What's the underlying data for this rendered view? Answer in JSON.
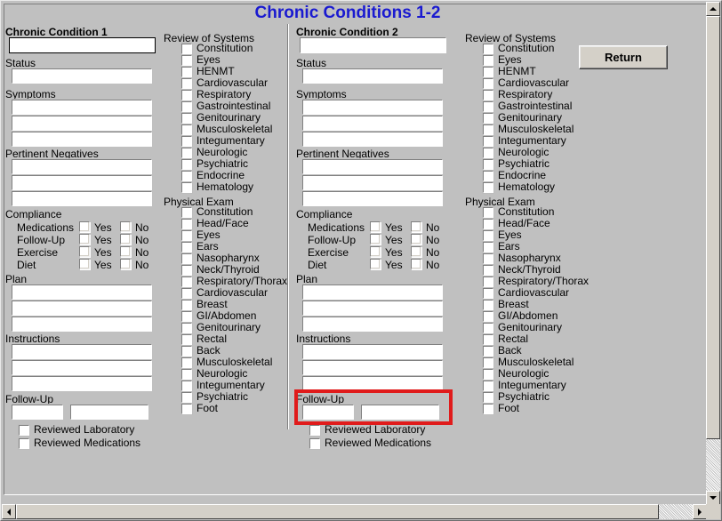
{
  "window": {
    "title": "Chronic Conditions 1-2",
    "title_color": "#1a1ad0",
    "background_color": "#c0c0c0"
  },
  "toolbar": {
    "return_label": "Return"
  },
  "highlight": {
    "color": "#e01b1b",
    "target": "follow-up-section-column-2"
  },
  "labels": {
    "status": "Status",
    "symptoms": "Symptoms",
    "pertinent_negatives": "Pertinent Negatives",
    "compliance": "Compliance",
    "plan": "Plan",
    "instructions": "Instructions",
    "follow_up": "Follow-Up",
    "review_of_systems": "Review of Systems",
    "physical_exam": "Physical Exam",
    "yes": "Yes",
    "no": "No"
  },
  "columns": [
    {
      "heading": "Chronic Condition 1",
      "condition_value": "",
      "condition_focused": true,
      "status_value": "",
      "symptoms_values": [
        "",
        "",
        ""
      ],
      "pertinent_negatives_values": [
        "",
        "",
        ""
      ],
      "compliance_rows": [
        "Medications",
        "Follow-Up",
        "Exercise",
        "Diet"
      ],
      "plan_values": [
        "",
        "",
        ""
      ],
      "instructions_values": [
        "",
        "",
        ""
      ],
      "follow_up_values": [
        "",
        ""
      ],
      "reviewed": [
        "Reviewed Laboratory",
        "Reviewed Medications"
      ],
      "review_of_systems": [
        "Constitution",
        "Eyes",
        "HENMT",
        "Cardiovascular",
        "Respiratory",
        "Gastrointestinal",
        "Genitourinary",
        "Musculoskeletal",
        "Integumentary",
        "Neurologic",
        "Psychiatric",
        "Endocrine",
        "Hematology"
      ],
      "physical_exam": [
        "Constitution",
        "Head/Face",
        "Eyes",
        "Ears",
        "Nasopharynx",
        "Neck/Thyroid",
        "Respiratory/Thorax",
        "Cardiovascular",
        "Breast",
        "GI/Abdomen",
        "Genitourinary",
        "Rectal",
        "Back",
        "Musculoskeletal",
        "Neurologic",
        "Integumentary",
        "Psychiatric",
        "Foot"
      ]
    },
    {
      "heading": "Chronic Condition 2",
      "condition_value": "",
      "condition_focused": false,
      "status_value": "",
      "symptoms_values": [
        "",
        "",
        ""
      ],
      "pertinent_negatives_values": [
        "",
        "",
        ""
      ],
      "compliance_rows": [
        "Medications",
        "Follow-Up",
        "Exercise",
        "Diet"
      ],
      "plan_values": [
        "",
        "",
        ""
      ],
      "instructions_values": [
        "",
        "",
        ""
      ],
      "follow_up_values": [
        "",
        ""
      ],
      "reviewed": [
        "Reviewed Laboratory",
        "Reviewed Medications"
      ],
      "review_of_systems": [
        "Constitution",
        "Eyes",
        "HENMT",
        "Cardiovascular",
        "Respiratory",
        "Gastrointestinal",
        "Genitourinary",
        "Musculoskeletal",
        "Integumentary",
        "Neurologic",
        "Psychiatric",
        "Endocrine",
        "Hematology"
      ],
      "physical_exam": [
        "Constitution",
        "Head/Face",
        "Eyes",
        "Ears",
        "Nasopharynx",
        "Neck/Thyroid",
        "Respiratory/Thorax",
        "Cardiovascular",
        "Breast",
        "GI/Abdomen",
        "Genitourinary",
        "Rectal",
        "Back",
        "Musculoskeletal",
        "Neurologic",
        "Integumentary",
        "Psychiatric",
        "Foot"
      ]
    }
  ],
  "scrollbars": {
    "vertical": {
      "up_icon": "scroll-up-arrow",
      "down_icon": "scroll-down-arrow"
    },
    "horizontal": {
      "left_icon": "scroll-left-arrow",
      "right_icon": "scroll-right-arrow"
    }
  }
}
